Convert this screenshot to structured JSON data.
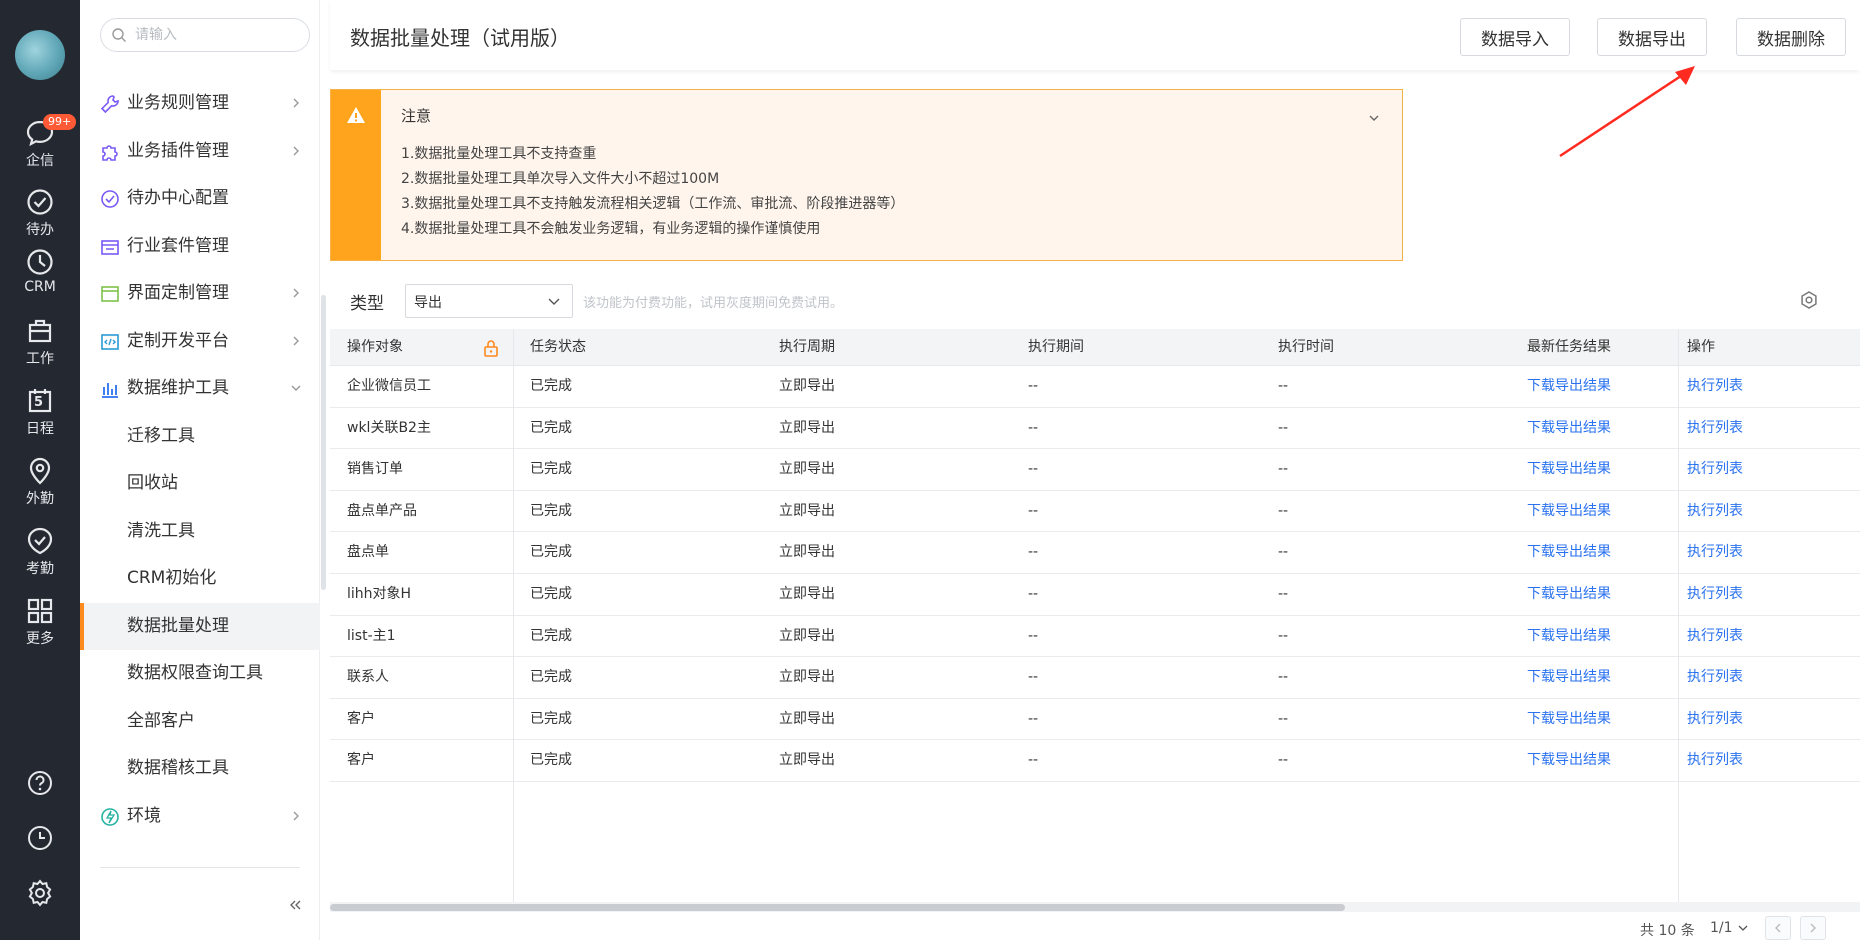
{
  "rail": {
    "items": [
      {
        "label": "企信",
        "icon": "chat-bubble-icon",
        "badge": "99+"
      },
      {
        "label": "待办",
        "icon": "check-circle-icon"
      },
      {
        "label": "CRM",
        "icon": "clock-icon"
      },
      {
        "label": "工作",
        "icon": "briefcase-icon"
      },
      {
        "label": "日程",
        "icon": "calendar-icon",
        "day": "5"
      },
      {
        "label": "外勤",
        "icon": "location-pin-icon"
      },
      {
        "label": "考勤",
        "icon": "shield-check-icon"
      },
      {
        "label": "更多",
        "icon": "grid-icon"
      }
    ],
    "bottom": [
      "help-icon",
      "history-icon",
      "gear-icon"
    ]
  },
  "sidebar": {
    "search_placeholder": "请输入",
    "items": [
      {
        "label": "业务规则管理",
        "icon": "wrench-icon",
        "arrow": "right"
      },
      {
        "label": "业务插件管理",
        "icon": "puzzle-icon",
        "arrow": "right"
      },
      {
        "label": "待办中心配置",
        "icon": "check-circle-icon",
        "arrow": ""
      },
      {
        "label": "行业套件管理",
        "icon": "suite-icon",
        "arrow": ""
      },
      {
        "label": "界面定制管理",
        "icon": "window-icon",
        "arrow": "right"
      },
      {
        "label": "定制开发平台",
        "icon": "code-icon",
        "arrow": "right"
      },
      {
        "label": "数据维护工具",
        "icon": "bar-chart-icon",
        "arrow": "down"
      },
      {
        "label": "迁移工具",
        "sub": true
      },
      {
        "label": "回收站",
        "sub": true
      },
      {
        "label": "清洗工具",
        "sub": true
      },
      {
        "label": "CRM初始化",
        "sub": true
      },
      {
        "label": "数据批量处理",
        "sub": true,
        "active": true
      },
      {
        "label": "数据权限查询工具",
        "sub": true
      },
      {
        "label": "全部客户",
        "sub": true
      },
      {
        "label": "数据稽核工具",
        "sub": true
      },
      {
        "label": "环境",
        "icon": "environment-icon",
        "arrow": "right"
      }
    ]
  },
  "header": {
    "title": "数据批量处理（试用版）",
    "buttons": {
      "import": "数据导入",
      "export": "数据导出",
      "delete": "数据删除"
    }
  },
  "notice": {
    "title": "注意",
    "lines": [
      "1.数据批量处理工具不支持查重",
      "2.数据批量处理工具单次导入文件大小不超过100M",
      "3.数据批量处理工具不支持触发流程相关逻辑（工作流、审批流、阶段推进器等）",
      "4.数据批量处理工具不会触发业务逻辑，有业务逻辑的操作谨慎使用"
    ]
  },
  "filter": {
    "label": "类型",
    "selected": "导出",
    "hint": "该功能为付费功能，试用灰度期间免费试用。"
  },
  "table": {
    "headers": [
      "操作对象",
      "任务状态",
      "执行周期",
      "执行期间",
      "执行时间",
      "最新任务结果",
      "操作"
    ],
    "rows": [
      {
        "object": "企业微信员工",
        "status": "已完成",
        "cycle": "立即导出",
        "period": "--",
        "time": "--",
        "result": "下载导出结果",
        "action": "执行列表"
      },
      {
        "object": "wkl关联B2主",
        "status": "已完成",
        "cycle": "立即导出",
        "period": "--",
        "time": "--",
        "result": "下载导出结果",
        "action": "执行列表"
      },
      {
        "object": "销售订单",
        "status": "已完成",
        "cycle": "立即导出",
        "period": "--",
        "time": "--",
        "result": "下载导出结果",
        "action": "执行列表"
      },
      {
        "object": "盘点单产品",
        "status": "已完成",
        "cycle": "立即导出",
        "period": "--",
        "time": "--",
        "result": "下载导出结果",
        "action": "执行列表"
      },
      {
        "object": "盘点单",
        "status": "已完成",
        "cycle": "立即导出",
        "period": "--",
        "time": "--",
        "result": "下载导出结果",
        "action": "执行列表"
      },
      {
        "object": "lihh对象H",
        "status": "已完成",
        "cycle": "立即导出",
        "period": "--",
        "time": "--",
        "result": "下载导出结果",
        "action": "执行列表"
      },
      {
        "object": "list-主1",
        "status": "已完成",
        "cycle": "立即导出",
        "period": "--",
        "time": "--",
        "result": "下载导出结果",
        "action": "执行列表"
      },
      {
        "object": "联系人",
        "status": "已完成",
        "cycle": "立即导出",
        "period": "--",
        "time": "--",
        "result": "下载导出结果",
        "action": "执行列表"
      },
      {
        "object": "客户",
        "status": "已完成",
        "cycle": "立即导出",
        "period": "--",
        "time": "--",
        "result": "下载导出结果",
        "action": "执行列表"
      },
      {
        "object": "客户",
        "status": "已完成",
        "cycle": "立即导出",
        "period": "--",
        "time": "--",
        "result": "下载导出结果",
        "action": "执行列表"
      }
    ]
  },
  "pagination": {
    "total": "共 10 条",
    "page": "1/1"
  },
  "colors": {
    "rail": "#242931",
    "accent": "#ff8a1e",
    "link": "#2a72ef",
    "warning": "#ffa41c",
    "annotation_arrow": "#ff2a20"
  }
}
